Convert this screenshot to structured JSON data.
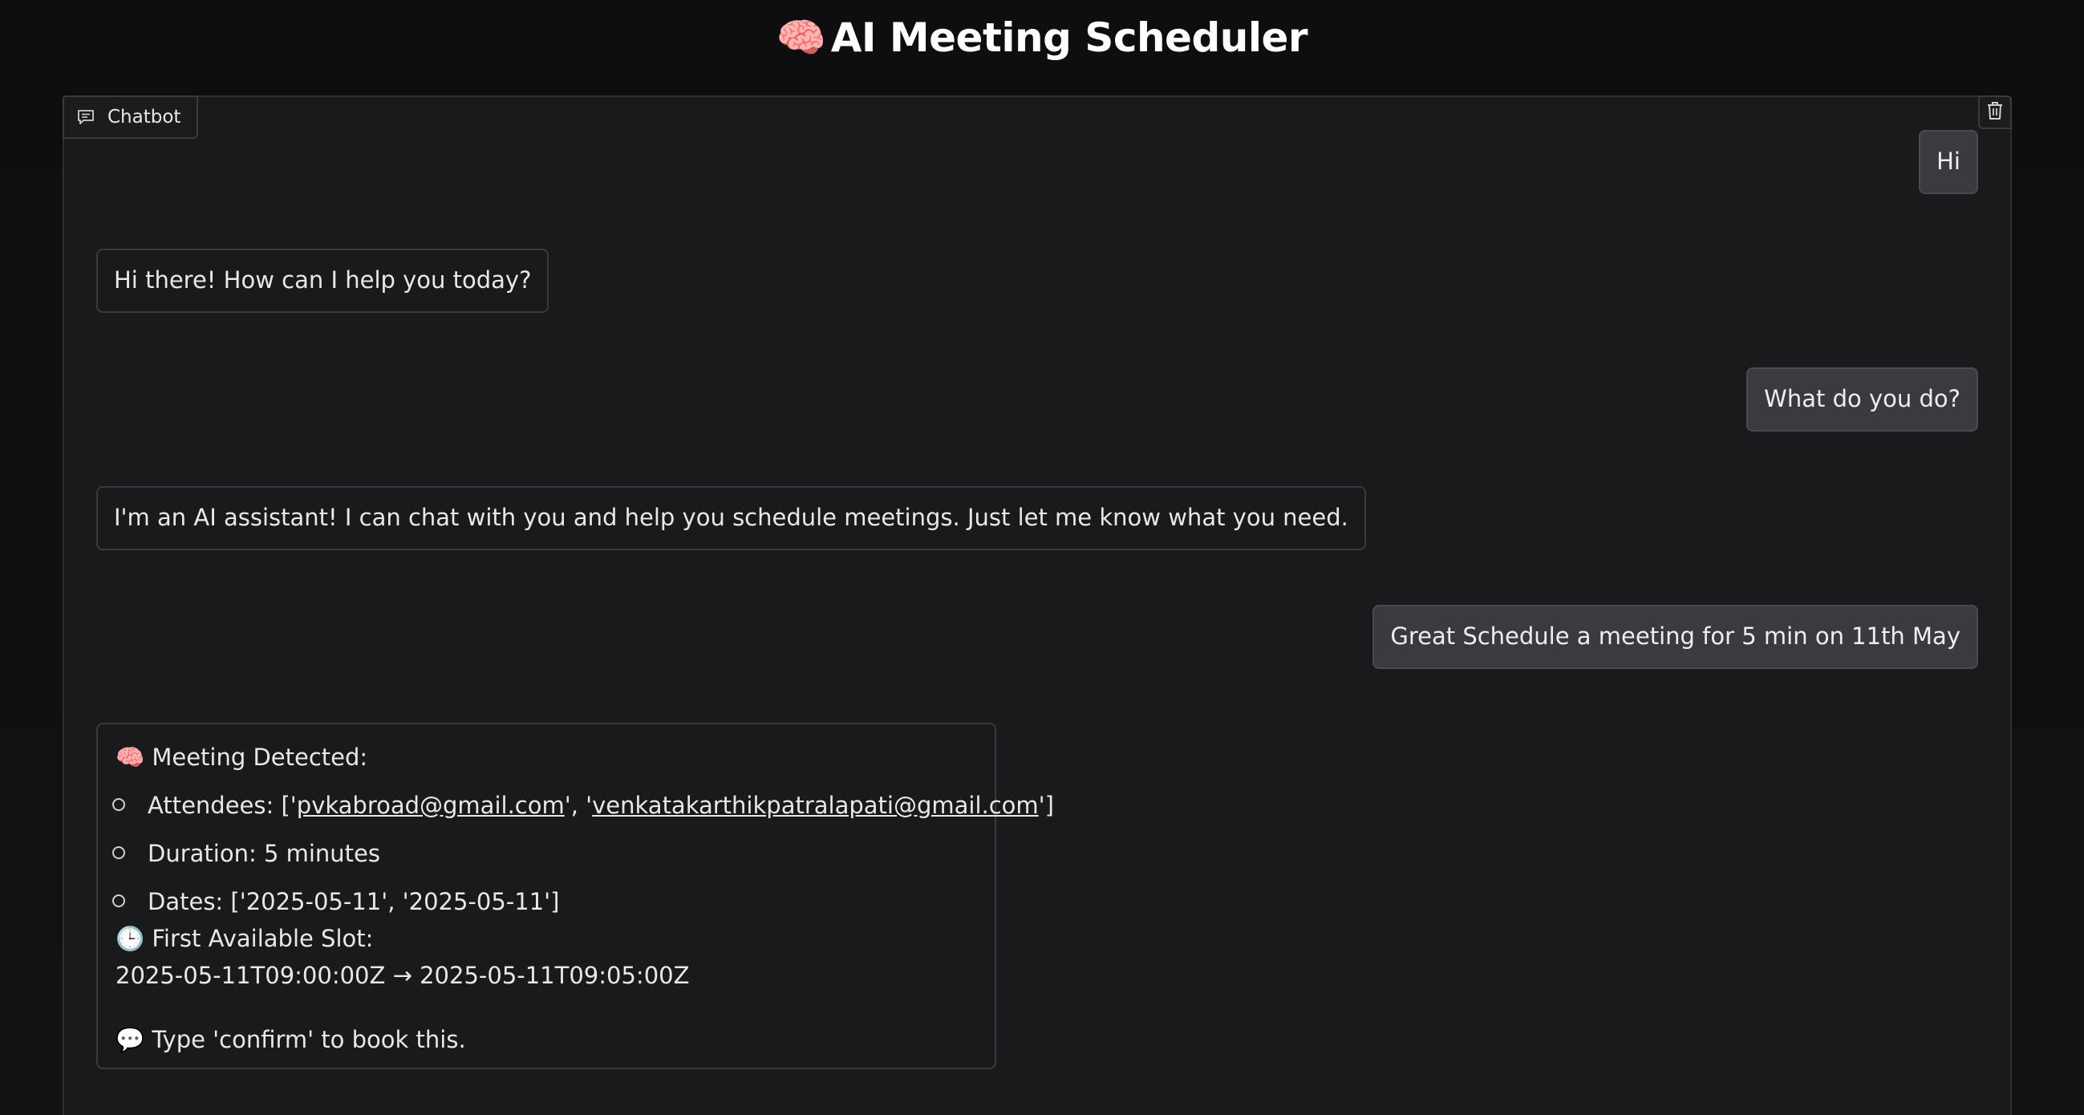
{
  "app": {
    "title_icon": "🧠",
    "title": "AI Meeting Scheduler"
  },
  "chat": {
    "label": "Chatbot",
    "label_icon": "chat-icon",
    "clear_icon": "trash-icon",
    "messages": [
      {
        "role": "user",
        "text": "Hi"
      },
      {
        "role": "bot",
        "text": "Hi there! How can I help you today?"
      },
      {
        "role": "user",
        "text": "What do you do?"
      },
      {
        "role": "bot",
        "text": "I'm an AI assistant! I can chat with you and help you schedule meetings. Just let me know what you need."
      },
      {
        "role": "user",
        "text": "Great Schedule a meeting for 5 min on 11th May"
      }
    ],
    "meeting": {
      "header_icon": "🧠",
      "header": "Meeting Detected:",
      "attendees_prefix": "Attendees: ['",
      "attendee_1": "pvkabroad@gmail.com",
      "attendee_sep": "', '",
      "attendee_2": "venkatakarthikpatralapati@gmail.com",
      "attendees_suffix": "']",
      "duration": "Duration: 5 minutes",
      "dates": "Dates: ['2025-05-11', '2025-05-11']",
      "slot_icon": "🕒",
      "slot_label": "First Available Slot:",
      "slot_value": "2025-05-11T09:00:00Z → 2025-05-11T09:05:00Z",
      "confirm_icon": "💬",
      "confirm_text": "Type 'confirm' to book this."
    }
  }
}
